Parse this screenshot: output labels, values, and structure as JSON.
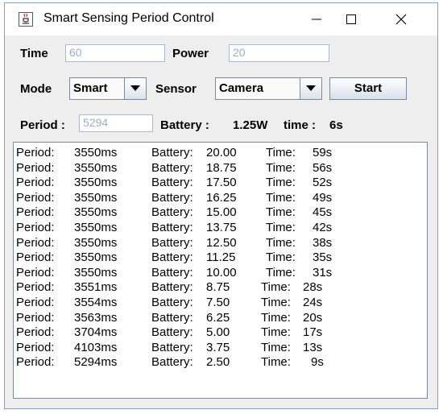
{
  "window": {
    "title": "Smart Sensing Period Control"
  },
  "controls": {
    "time_label": "Time",
    "time_value": "60",
    "power_label": "Power",
    "power_value": "20",
    "mode_label": "Mode",
    "mode_selected": "Smart",
    "sensor_label": "Sensor",
    "sensor_selected": "Camera",
    "start_label": "Start",
    "period_label": "Period :",
    "period_value": "5294",
    "battery_label": "Battery :",
    "battery_value": "1.25W",
    "time_status_label": "time :",
    "time_status_value": "6s"
  },
  "log": [
    {
      "period_label": "Period:",
      "period": "3550ms",
      "battery_label": "Battery:",
      "battery": "20.00",
      "time_label": "Time:",
      "time": "59s"
    },
    {
      "period_label": "Period:",
      "period": "3550ms",
      "battery_label": "Battery:",
      "battery": "18.75",
      "time_label": "Time:",
      "time": "56s"
    },
    {
      "period_label": "Period:",
      "period": "3550ms",
      "battery_label": "Battery:",
      "battery": "17.50",
      "time_label": "Time:",
      "time": "52s"
    },
    {
      "period_label": "Period:",
      "period": "3550ms",
      "battery_label": "Battery:",
      "battery": "16.25",
      "time_label": "Time:",
      "time": "49s"
    },
    {
      "period_label": "Period:",
      "period": "3550ms",
      "battery_label": "Battery:",
      "battery": "15.00",
      "time_label": "Time:",
      "time": "45s"
    },
    {
      "period_label": "Period:",
      "period": "3550ms",
      "battery_label": "Battery:",
      "battery": "13.75",
      "time_label": "Time:",
      "time": "42s"
    },
    {
      "period_label": "Period:",
      "period": "3550ms",
      "battery_label": "Battery:",
      "battery": "12.50",
      "time_label": "Time:",
      "time": "38s"
    },
    {
      "period_label": "Period:",
      "period": "3550ms",
      "battery_label": "Battery:",
      "battery": "11.25",
      "time_label": "Time:",
      "time": "35s"
    },
    {
      "period_label": "Period:",
      "period": "3550ms",
      "battery_label": "Battery:",
      "battery": "10.00",
      "time_label": "Time:",
      "time": "31s"
    },
    {
      "period_label": "Period:",
      "period": "3551ms",
      "battery_label": "Battery:",
      "battery": "8.75",
      "time_label": "Time:",
      "time": "28s"
    },
    {
      "period_label": "Period:",
      "period": "3554ms",
      "battery_label": "Battery:",
      "battery": "7.50",
      "time_label": "Time:",
      "time": "24s"
    },
    {
      "period_label": "Period:",
      "period": "3563ms",
      "battery_label": "Battery:",
      "battery": "6.25",
      "time_label": "Time:",
      "time": "20s"
    },
    {
      "period_label": "Period:",
      "period": "3704ms",
      "battery_label": "Battery:",
      "battery": "5.00",
      "time_label": "Time:",
      "time": "17s"
    },
    {
      "period_label": "Period:",
      "period": "4103ms",
      "battery_label": "Battery:",
      "battery": "3.75",
      "time_label": "Time:",
      "time": "13s"
    },
    {
      "period_label": "Period:",
      "period": "5294ms",
      "battery_label": "Battery:",
      "battery": "2.50",
      "time_label": "Time:",
      "time": "9s"
    }
  ]
}
